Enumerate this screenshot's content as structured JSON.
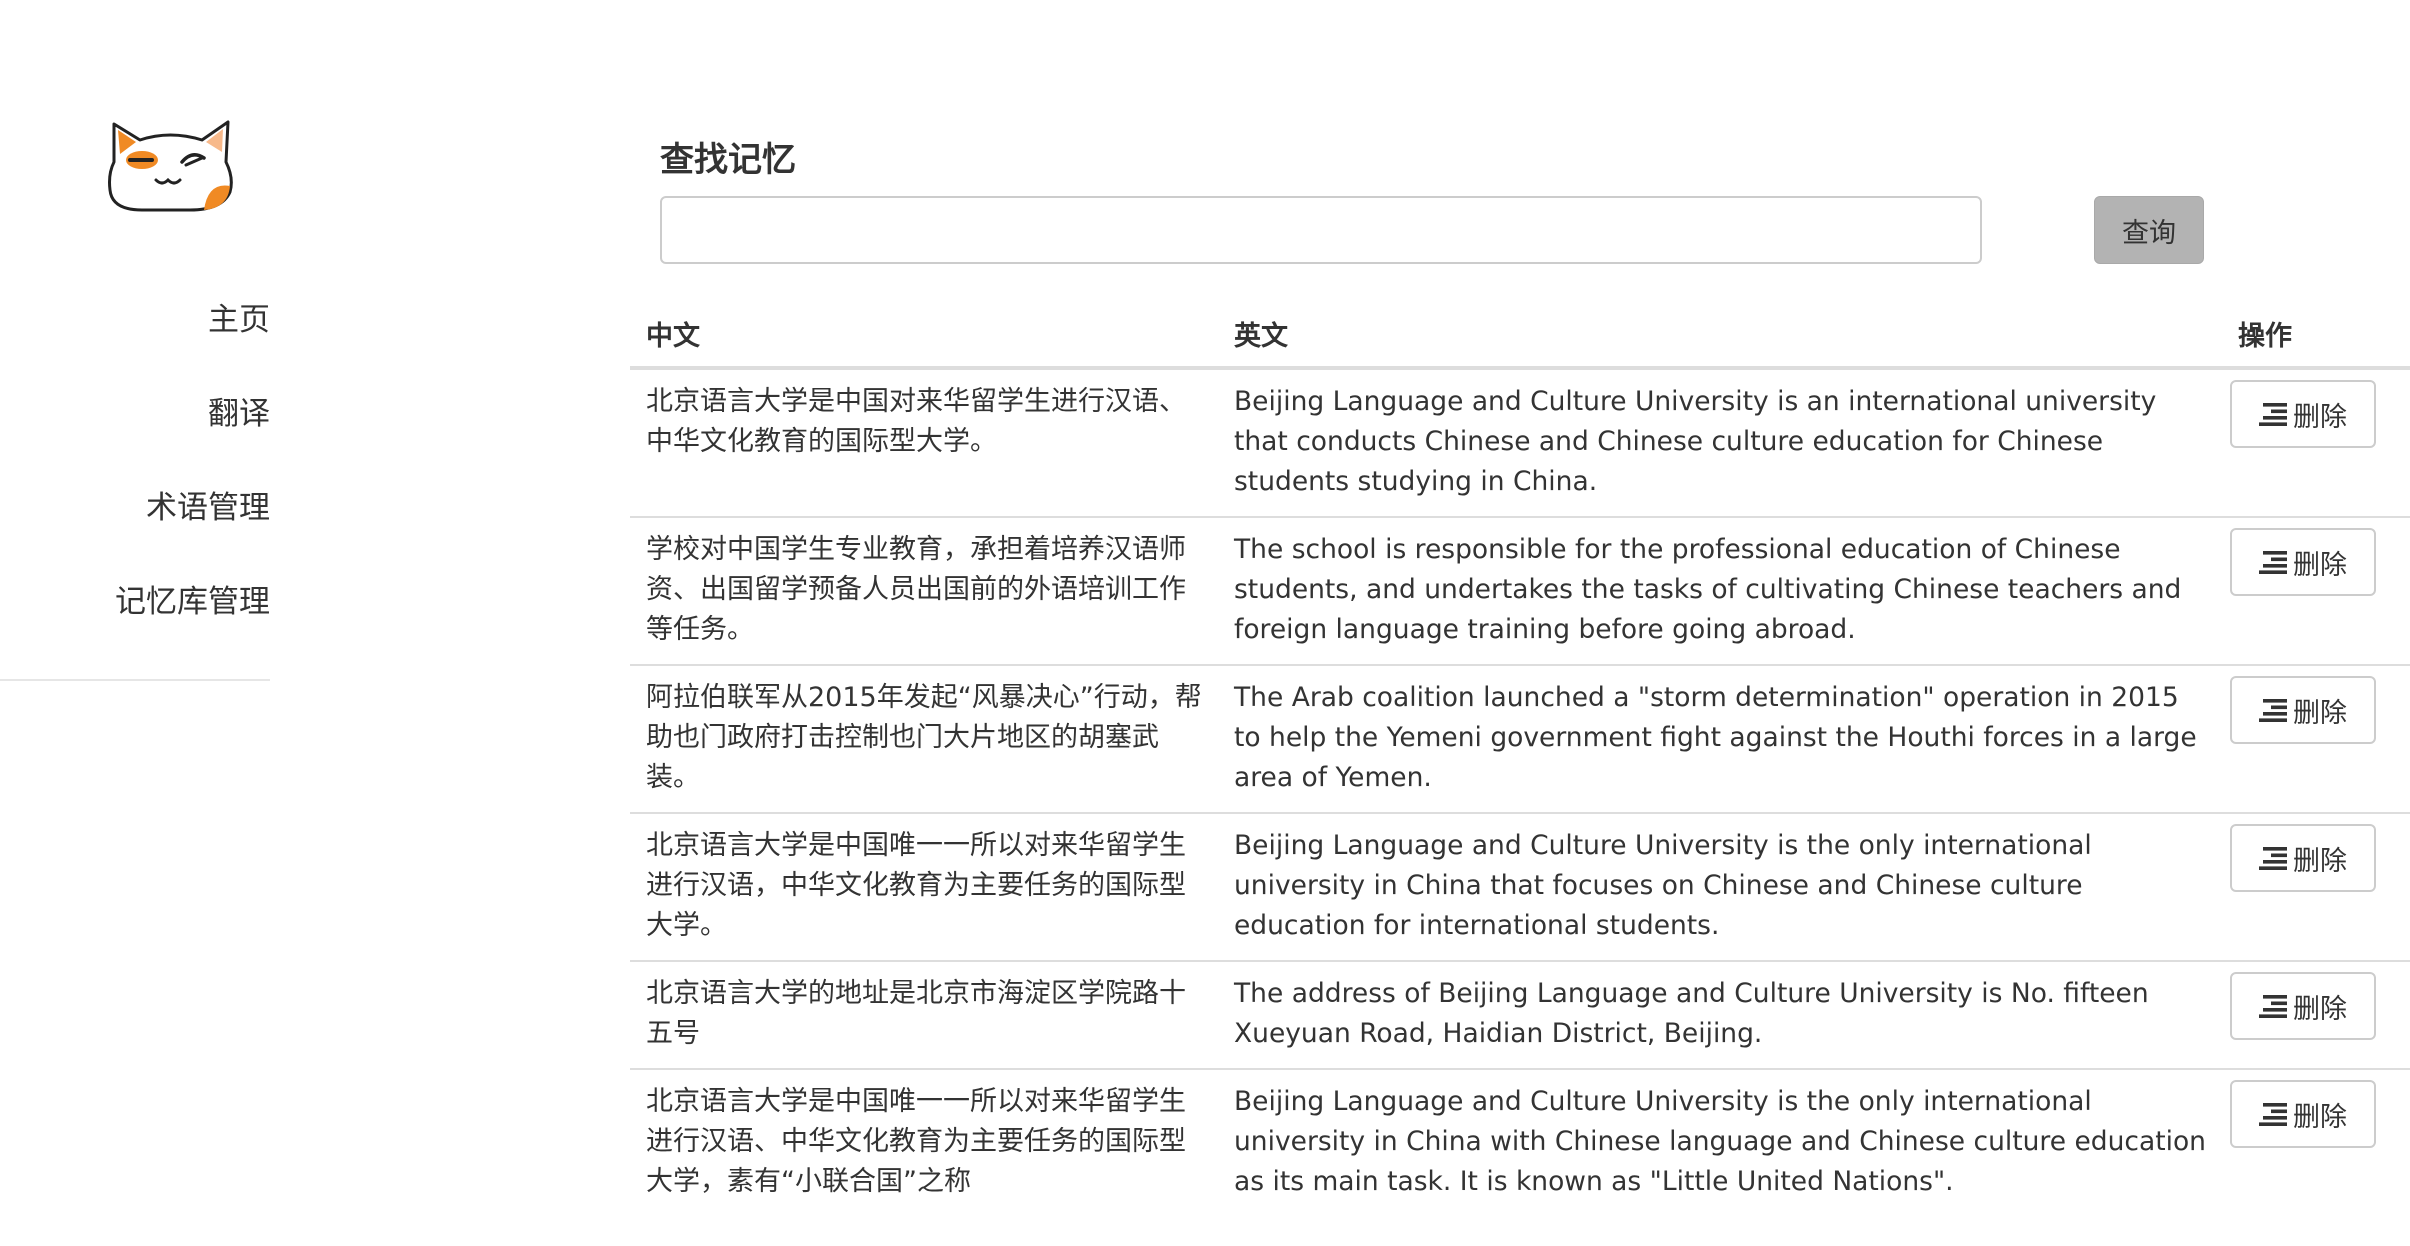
{
  "sidebar": {
    "items": [
      {
        "label": "主页"
      },
      {
        "label": "翻译"
      },
      {
        "label": "术语管理"
      },
      {
        "label": "记忆库管理"
      }
    ]
  },
  "search": {
    "title": "查找记忆",
    "value": "",
    "placeholder": "",
    "button_label": "查询"
  },
  "table": {
    "headers": {
      "chinese": "中文",
      "english": "英文",
      "actions": "操作"
    },
    "delete_label": "删除",
    "delete_icon": "align-right-icon",
    "rows": [
      {
        "chinese": "北京语言大学是中国对来华留学生进行汉语、中华文化教育的国际型大学。",
        "english": "Beijing Language and Culture University is an international university that conducts Chinese and Chinese culture education for Chinese students studying in China."
      },
      {
        "chinese": "学校对中国学生专业教育，承担着培养汉语师资、出国留学预备人员出国前的外语培训工作等任务。",
        "english": "The school is responsible for the professional education of Chinese students, and undertakes the tasks of cultivating Chinese teachers and foreign language training before going abroad."
      },
      {
        "chinese": "阿拉伯联军从2015年发起“风暴决心”行动，帮助也门政府打击控制也门大片地区的胡塞武装。",
        "english": "The Arab coalition launched a \"storm determination\" operation in 2015 to help the Yemeni government fight against the Houthi forces in a large area of Yemen."
      },
      {
        "chinese": "北京语言大学是中国唯一一所以对来华留学生进行汉语，中华文化教育为主要任务的国际型大学。",
        "english": "Beijing Language and Culture University is the only international university in China that focuses on Chinese and Chinese culture education for international students."
      },
      {
        "chinese": "北京语言大学的地址是北京市海淀区学院路十五号",
        "english": "The address of Beijing Language and Culture University is No. fifteen Xueyuan Road, Haidian District, Beijing."
      },
      {
        "chinese": "北京语言大学是中国唯一一所以对来华留学生进行汉语、中华文化教育为主要任务的国际型大学，素有“小联合国”之称",
        "english": "Beijing Language and Culture University is the only international university in China with Chinese language and Chinese culture education as its main task. It is known as \"Little United Nations\"."
      }
    ]
  },
  "colors": {
    "logo_orange": "#f08a24",
    "search_button_bg": "#b3b3b3",
    "border": "#cccccc",
    "text": "#333333"
  }
}
